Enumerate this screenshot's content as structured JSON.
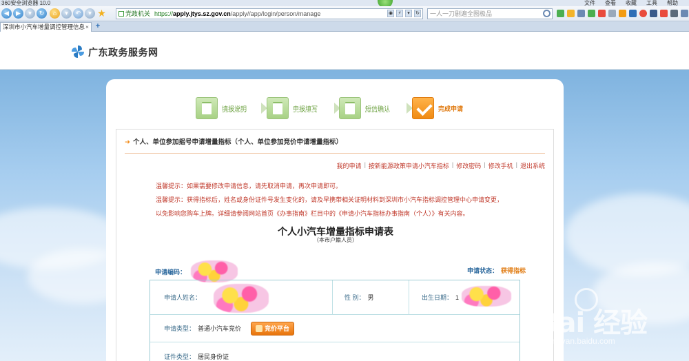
{
  "browser": {
    "title": "360安全浏览器 10.0",
    "menus": [
      "文件",
      "查看",
      "收藏",
      "工具",
      "帮助"
    ],
    "address_chip": "党政机关",
    "url_scheme": "https://",
    "url_host": "apply.jtys.sz.gov.cn",
    "url_path": "/apply//app/login/person/manage",
    "search_placeholder": "一人一刀剧遍全图极品",
    "tab_title": "深圳市小汽车增量调控管理信息",
    "tab_close": "×",
    "new_tab": "+"
  },
  "site": {
    "title": "广东政务服务网",
    "logo_icon": "pinwheel-logo-icon"
  },
  "steps": [
    {
      "label": "填报说明"
    },
    {
      "label": "申报填写"
    },
    {
      "label": "短信确认"
    },
    {
      "label": "完成申请"
    }
  ],
  "section": {
    "title": "个人、单位参加摇号申请增量指标（个人、单位参加竞价申请增量指标）"
  },
  "links": [
    "我的申请",
    "按新能源政策申请小汽车指标",
    "修改密码",
    "修改手机",
    "退出系统"
  ],
  "tips": {
    "line1": "温馨提示：如果需要修改申请信息，请先取消申请，再次申请即可。",
    "line2": "温馨提示：获得指标后，姓名或身份证件号发生变化的，请及早携带相关证明材料到深圳市小汽车指标调控管理中心申请变更，",
    "line3": "以免影响您购车上牌。详细请参阅网站首页《办事指南》栏目中的《申请小汽车指标办事指南（个人）》有关内容。"
  },
  "form": {
    "title": "个人小汽车增量指标申请表",
    "subtitle": "（本市户籍人员）",
    "code_label": "申请编码：",
    "status_label": "申请状态：",
    "status_value": "获得指标",
    "name_label": "申请人姓名：",
    "gender_label": "性 别：",
    "gender_value": "男",
    "birth_label": "出生日期：",
    "birth_value": "1",
    "type_label": "申请类型：",
    "type_value": "普通小汽车竞价",
    "bid_button": "竞价平台",
    "idtype_label": "证件类型：",
    "idtype_value": "居民身份证"
  },
  "watermark": {
    "big": "Bai 经验",
    "small": "jingyan.baidu.com"
  }
}
